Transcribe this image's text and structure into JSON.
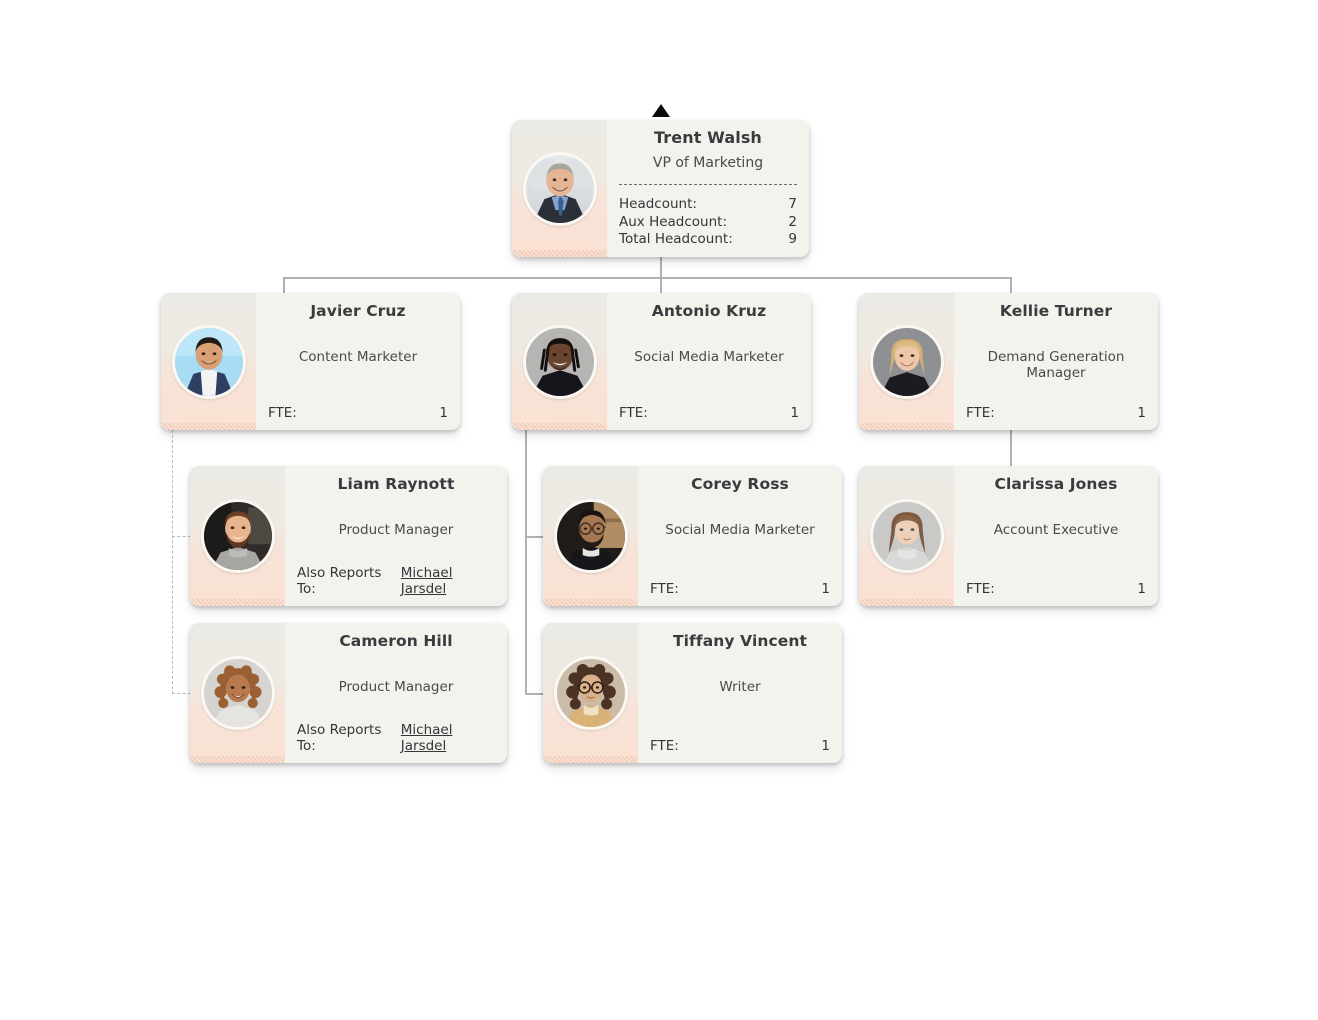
{
  "chart": {
    "root_marker_icon": "up-triangle-icon",
    "fte_label": "FTE:",
    "also_reports_label": "Also Reports To:",
    "colors": {
      "card_bg": "#f4f2ec",
      "photo_panel_bottom": "#fae1d3",
      "connector": "#b1b1b1",
      "text": "#35353a"
    }
  },
  "nodes": {
    "root": {
      "name": "Trent Walsh",
      "title": "VP of Marketing",
      "stats": [
        {
          "label": "Headcount:",
          "value": "7"
        },
        {
          "label": "Aux Headcount:",
          "value": "2"
        },
        {
          "label": "Total Headcount:",
          "value": "9"
        }
      ]
    },
    "javier": {
      "name": "Javier Cruz",
      "title": "Content Marketer",
      "footer_label": "FTE:",
      "footer_value": "1"
    },
    "antonio": {
      "name": "Antonio Kruz",
      "title": "Social Media Marketer",
      "footer_label": "FTE:",
      "footer_value": "1"
    },
    "kellie": {
      "name": "Kellie Turner",
      "title": "Demand Generation Manager",
      "footer_label": "FTE:",
      "footer_value": "1"
    },
    "liam": {
      "name": "Liam Raynott",
      "title": "Product Manager",
      "footer_label": "Also Reports To:",
      "footer_value": "Michael Jarsdel"
    },
    "corey": {
      "name": "Corey Ross",
      "title": "Social Media Marketer",
      "footer_label": "FTE:",
      "footer_value": "1"
    },
    "clarissa": {
      "name": "Clarissa Jones",
      "title": "Account Executive",
      "footer_label": "FTE:",
      "footer_value": "1"
    },
    "cameron": {
      "name": "Cameron Hill",
      "title": "Product Manager",
      "footer_label": "Also Reports To:",
      "footer_value": "Michael Jarsdel"
    },
    "tiffany": {
      "name": "Tiffany Vincent",
      "title": "Writer",
      "footer_label": "FTE:",
      "footer_value": "1"
    }
  }
}
